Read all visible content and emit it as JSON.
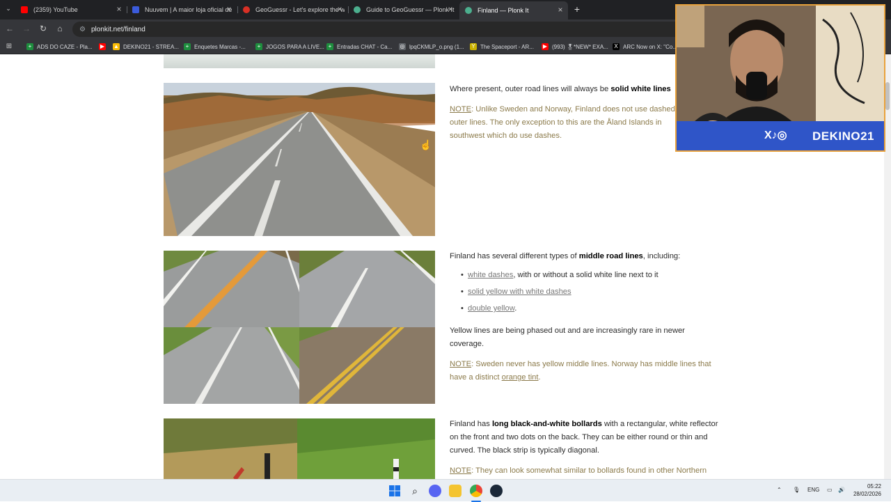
{
  "browser": {
    "tabs": [
      {
        "title": "(2359) YouTube",
        "color": "#ff0000"
      },
      {
        "title": "Nuuvem | A maior loja oficial de",
        "color": "#3b5bdb"
      },
      {
        "title": "GeoGuessr - Let's explore the w",
        "color": "#d93025"
      },
      {
        "title": "Guide to GeoGuessr — Plonk It",
        "color": "#4caf8e"
      },
      {
        "title": "Finland — Plonk It",
        "color": "#4caf8e"
      }
    ],
    "url": "plonkit.net/finland",
    "bookmarks": [
      {
        "label": "ADS DO CAZE - Pla...",
        "color": "#1e8e3e",
        "icon": "+"
      },
      {
        "label": "",
        "color": "#ff0000",
        "icon": "▶"
      },
      {
        "label": "DEKINO21 - STREA...",
        "color": "#fbbc04",
        "icon": "▲"
      },
      {
        "label": "Enquetes Marcas -...",
        "color": "#1e8e3e",
        "icon": "+"
      },
      {
        "label": "JOGOS PARA A LIVE...",
        "color": "#1e8e3e",
        "icon": "+"
      },
      {
        "label": "Entradas CHAT - Ca...",
        "color": "#1e8e3e",
        "icon": "+"
      },
      {
        "label": "lpqCKMLP_o.png (1...",
        "color": "#5f6368",
        "icon": "◎"
      },
      {
        "label": "The Spaceport - AR...",
        "color": "#c9b100",
        "icon": "Y"
      },
      {
        "label": "(993) 🎖*NEW* EXA...",
        "color": "#ff0000",
        "icon": "▶"
      },
      {
        "label": "ARC Now on X: \"Co...",
        "color": "#000000",
        "icon": "X"
      }
    ]
  },
  "article": {
    "s1": {
      "pre": "Where present, outer road lines will always be ",
      "bold": "solid white lines",
      "note_label": "NOTE",
      "note_text": ": Unlike Sweden and Norway, Finland does not use dashed outer lines. The only exception to this are the Åland Islands in southwest which do use dashes."
    },
    "s2": {
      "pre": "Finland has several different types of ",
      "bold": "middle road lines",
      "post": ", including:",
      "bullets": [
        {
          "link": "white dashes",
          "rest": ", with or without a solid white line next to it"
        },
        {
          "link": "solid yellow with white dashes",
          "rest": ""
        },
        {
          "link": "double yellow",
          "rest": "."
        }
      ],
      "yellow_text": "Yellow lines are being phased out and are increasingly rare in newer coverage.",
      "note_label": "NOTE",
      "note_text": ": Sweden never has yellow middle lines. Norway has middle lines that have a distinct ",
      "note_link": "orange tint",
      "note_end": "."
    },
    "s3": {
      "pre": "Finland has ",
      "bold": "long black-and-white bollards",
      "post": " with a rectangular, white reflector on the front and two dots on the back. They can be either round or thin and curved. The black strip is typically diagonal.",
      "note_label": "NOTE",
      "note_text": ": They can look somewhat similar to bollards found in other Northern"
    }
  },
  "webcam": {
    "channel": "DEKINO21",
    "social_icons": "X♪◎"
  },
  "taskbar": {
    "lang": "ENG",
    "time": "05:22",
    "date": "28/02/2026"
  }
}
